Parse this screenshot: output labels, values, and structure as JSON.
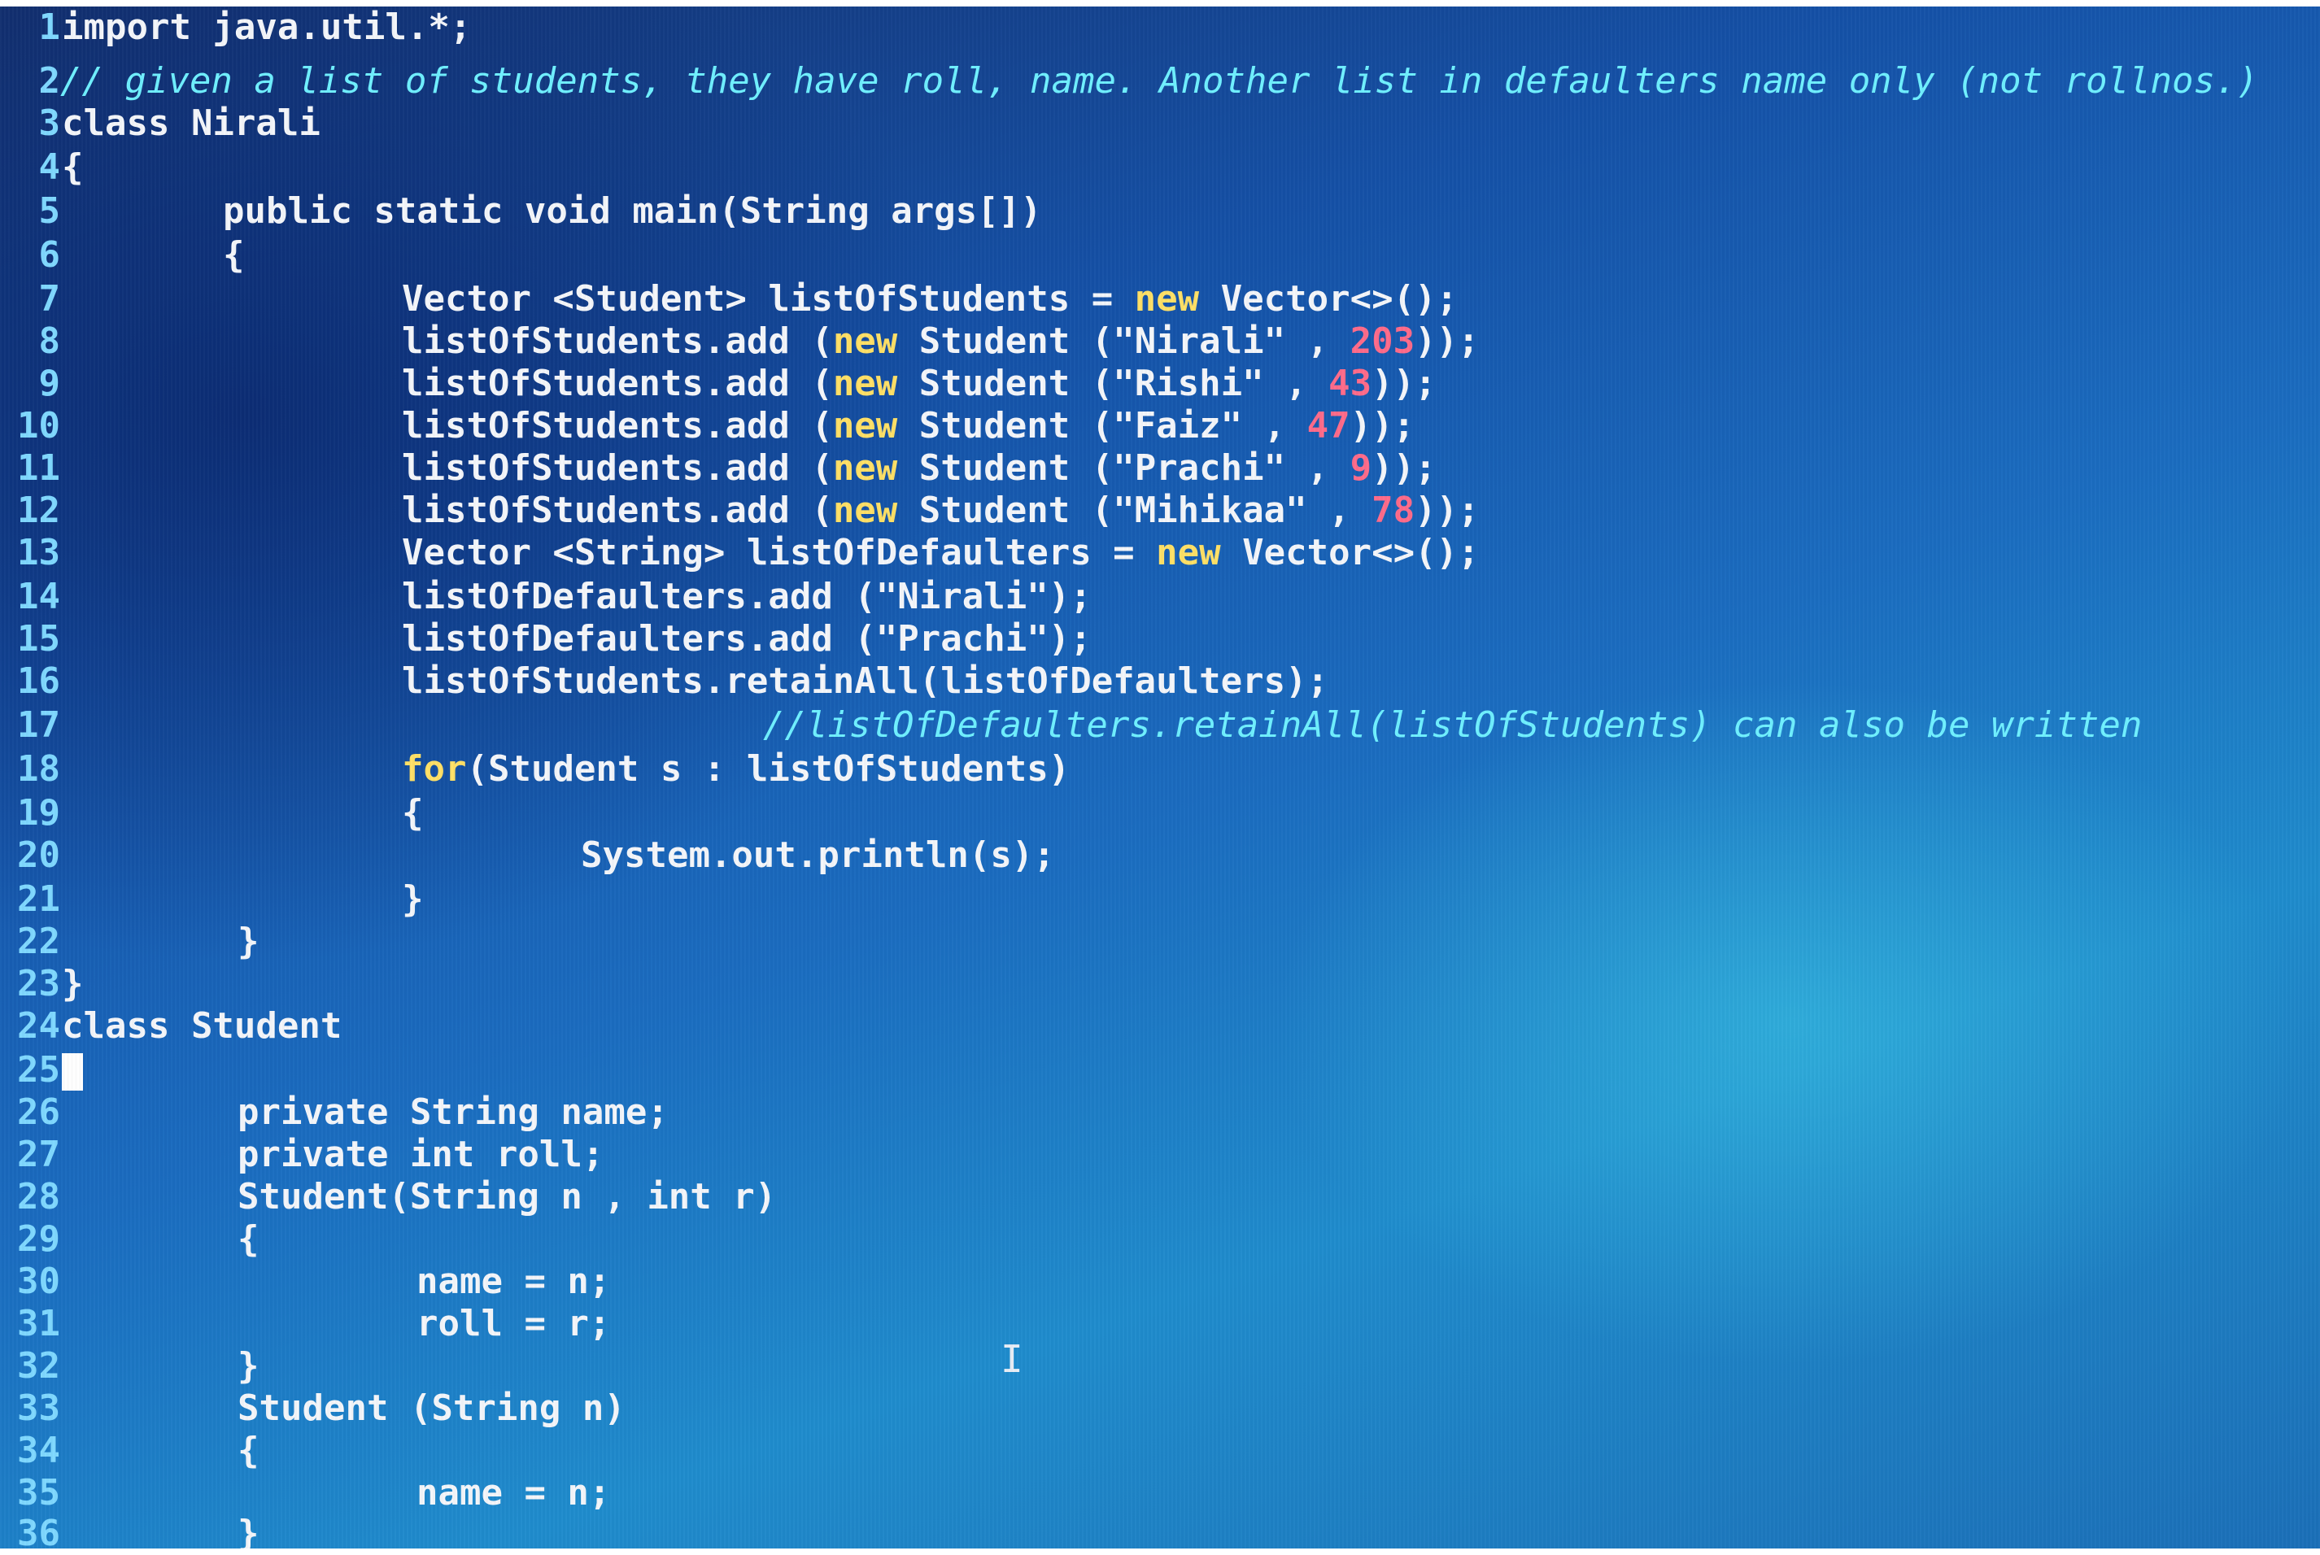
{
  "editor": {
    "line_numbers": [
      "1",
      "2",
      "3",
      "4",
      "5",
      "6",
      "7",
      "8",
      "9",
      "10",
      "11",
      "12",
      "13",
      "14",
      "15",
      "16",
      "17",
      "18",
      "19",
      "20",
      "21",
      "22",
      "23",
      "24",
      "25",
      "26",
      "27",
      "28",
      "29",
      "30",
      "31",
      "32",
      "33",
      "34",
      "35",
      "36"
    ],
    "lines": {
      "l1": "import java.util.*;",
      "l2": "// given a list of students, they have roll, name. Another list in defaulters name only (not rollnos.)",
      "l3": "class Nirali",
      "l4": "{",
      "l5": "public static void main(String args[])",
      "l6": "{",
      "l7_a": "Vector <Student> listOfStudents = ",
      "l7_kw": "new",
      "l7_b": " Vector<>();",
      "l8_a": "listOfStudents.add (",
      "l8_kw": "new",
      "l8_b": " Student (\"Nirali\" , ",
      "l8_num": "203",
      "l8_c": "));",
      "l9_a": "listOfStudents.add (",
      "l9_kw": "new",
      "l9_b": " Student (\"Rishi\" , ",
      "l9_num": "43",
      "l9_c": "));",
      "l10_a": "listOfStudents.add (",
      "l10_kw": "new",
      "l10_b": " Student (\"Faiz\" , ",
      "l10_num": "47",
      "l10_c": "));",
      "l11_a": "listOfStudents.add (",
      "l11_kw": "new",
      "l11_b": " Student (\"Prachi\" , ",
      "l11_num": "9",
      "l11_c": "));",
      "l12_a": "listOfStudents.add (",
      "l12_kw": "new",
      "l12_b": " Student (\"Mihikaa\" , ",
      "l12_num": "78",
      "l12_c": "));",
      "l13_a": "Vector <String> listOfDefaulters = ",
      "l13_kw": "new",
      "l13_b": " Vector<>();",
      "l14": "listOfDefaulters.add (\"Nirali\");",
      "l15": "listOfDefaulters.add (\"Prachi\");",
      "l16": "listOfStudents.retainAll(listOfDefaulters);",
      "l17": "//listOfDefaulters.retainAll(listOfStudents) can also be written",
      "l18_kw": "for",
      "l18_b": "(Student s : listOfStudents)",
      "l19": "{",
      "l20": "System.out.println(s);",
      "l21": "}",
      "l22": "}",
      "l23": "}",
      "l24": "class Student",
      "l26": "private String name;",
      "l27": "private int roll;",
      "l28": "Student(String n , int r)",
      "l29": "{",
      "l30": "name = n;",
      "l31": "roll = r;",
      "l32": "}",
      "l33": "Student (String n)",
      "l34": "{",
      "l35": "name = n;",
      "l36": "}"
    },
    "colors": {
      "background": "#1a5fb4",
      "text": "#f4f6fa",
      "line_number": "#7fd8ff",
      "keyword_new": "#ffe066",
      "number": "#ff6b8a",
      "comment": "#6ff0ff"
    }
  }
}
